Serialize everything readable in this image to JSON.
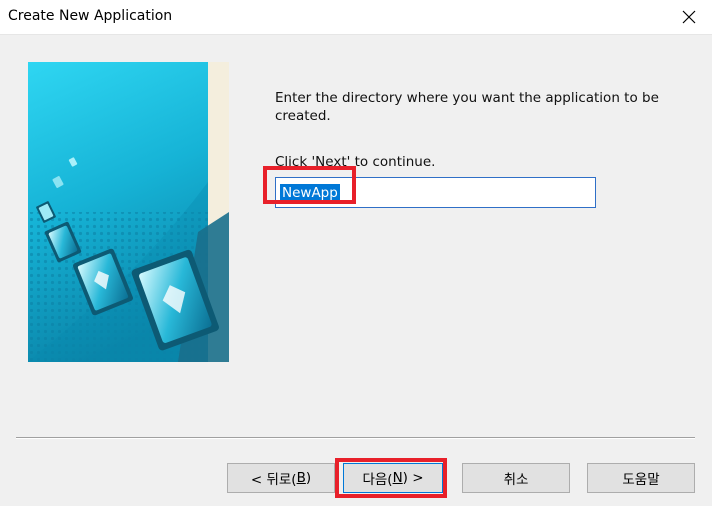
{
  "window": {
    "title": "Create New Application",
    "close_icon": "close-icon"
  },
  "wizard": {
    "instruction": "Enter the directory where you want the application to be created.",
    "continue_hint": "Click 'Next' to continue.",
    "directory_value": "NewApp",
    "banner_image": "monitors-banner-illustration"
  },
  "buttons": {
    "back_prefix": "< 뒤로(",
    "back_key": "B",
    "back_suffix": ")",
    "next_prefix": "다음(",
    "next_key": "N",
    "next_suffix": ") >",
    "cancel": "취소",
    "help": "도움말"
  },
  "annotations": {
    "highlight_color": "#e8202a",
    "highlighted": [
      "directory-input",
      "next-button"
    ]
  }
}
